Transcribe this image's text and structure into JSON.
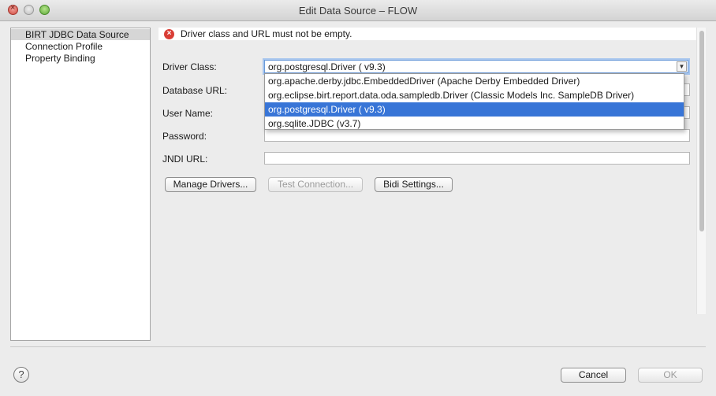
{
  "window": {
    "title": "Edit Data Source – FLOW"
  },
  "nav": {
    "items": [
      "BIRT JDBC Data Source",
      "Connection Profile",
      "Property Binding"
    ],
    "selected_index": 0
  },
  "error": {
    "message": "Driver class and URL must not be empty.",
    "icon": "error-icon"
  },
  "form": {
    "driver_class": {
      "label": "Driver Class:",
      "value": "org.postgresql.Driver ( v9.3)"
    },
    "database_url": {
      "label": "Database URL:",
      "value": ""
    },
    "user_name": {
      "label": "User Name:",
      "value": ""
    },
    "password": {
      "label": "Password:",
      "value": ""
    },
    "jndi_url": {
      "label": "JNDI URL:",
      "value": ""
    }
  },
  "dropdown": {
    "options": [
      "org.apache.derby.jdbc.EmbeddedDriver (Apache Derby Embedded Driver)",
      "org.eclipse.birt.report.data.oda.sampledb.Driver (Classic Models Inc. SampleDB Driver)",
      "org.postgresql.Driver ( v9.3)",
      "org.sqlite.JDBC (v3.7)"
    ],
    "selected_index": 2
  },
  "buttons": {
    "manage_drivers": "Manage Drivers...",
    "test_connection": "Test Connection...",
    "bidi_settings": "Bidi Settings...",
    "cancel": "Cancel",
    "ok": "OK"
  },
  "colors": {
    "selection": "#3875d7",
    "error": "#d93d35",
    "focus_ring": "#a8c6ee"
  }
}
